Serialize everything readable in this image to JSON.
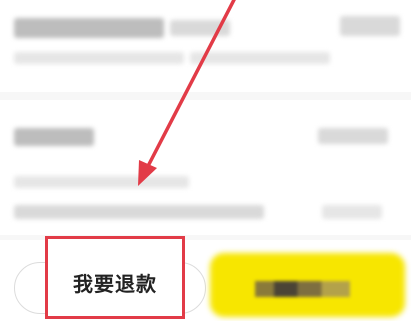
{
  "bottom_bar": {
    "refund_label": "我要退款"
  },
  "colors": {
    "highlight_red": "#e23b47",
    "primary_yellow": "#f7e600"
  }
}
